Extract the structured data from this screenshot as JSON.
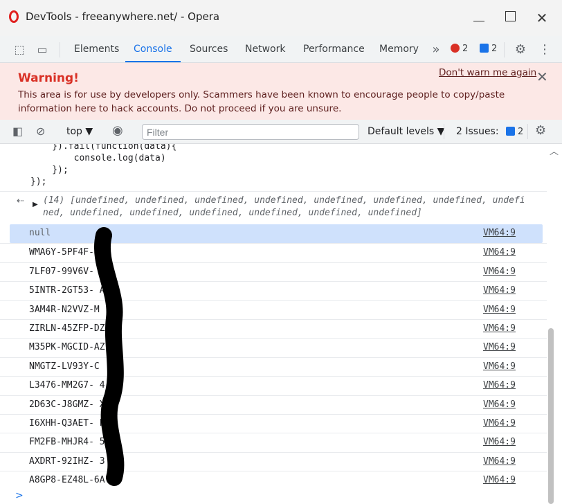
{
  "window": {
    "title": "DevTools - freeanywhere.net/ - Opera",
    "minimize_icon": "minimize-icon",
    "maximize_icon": "maximize-icon",
    "close_glyph": "✕"
  },
  "tabs": [
    {
      "label": "Elements"
    },
    {
      "label": "Console",
      "active": true
    },
    {
      "label": "Sources"
    },
    {
      "label": "Network"
    },
    {
      "label": "Performance"
    },
    {
      "label": "Memory"
    }
  ],
  "tabs_bar": {
    "more_tabs": "»",
    "errors_count": "2",
    "messages_count": "2",
    "settings_icon": "gear-icon",
    "menu_glyph": "⋮"
  },
  "warning": {
    "heading": "Warning!",
    "message": "This area is for use by developers only. Scammers have been known to encourage people to copy/paste information here to hack accounts. Do not proceed if you are unsure.",
    "dont_warn": "Don't warn me again",
    "close_glyph": "✕"
  },
  "console_toolbar": {
    "context": "top ▼",
    "filter_placeholder": "Filter",
    "filter_value": "",
    "levels": "Default levels ▼",
    "issues_label": "2 Issues:",
    "issues_count": "2"
  },
  "console": {
    "code_lines": [
      "    }).fail(function(data){",
      "        console.log(data)",
      "    });",
      "});"
    ],
    "result_text": "(14) [undefined, undefined, undefined, undefined, undefined, undefined, undefined, undefined, undefined, undefined, undefined, undefined, undefined, undefined]",
    "log_rows": [
      {
        "value": "null",
        "source": "VM64:9"
      },
      {
        "value": "WMA6Y-5PF4F-    DP",
        "source": "VM64:9"
      },
      {
        "value": "7LF07-99V6V-    ET",
        "source": "VM64:9"
      },
      {
        "value": "5INTR-2GT53-    A",
        "source": "VM64:9"
      },
      {
        "value": "3AM4R-N2VVZ-M",
        "source": "VM64:9"
      },
      {
        "value": "ZIRLN-45ZFP-DZ",
        "source": "VM64:9"
      },
      {
        "value": "M35PK-MGCID-AZ",
        "source": "VM64:9"
      },
      {
        "value": "NMGTZ-LV93Y-C",
        "source": "VM64:9"
      },
      {
        "value": "L3476-MM2G7-    4",
        "source": "VM64:9"
      },
      {
        "value": "2D63C-J8GMZ-    X",
        "source": "VM64:9"
      },
      {
        "value": "I6XHH-Q3AET-    P",
        "source": "VM64:9"
      },
      {
        "value": "FM2FB-MHJR4-    5E",
        "source": "VM64:9"
      },
      {
        "value": "AXDRT-92IHZ-    3",
        "source": "VM64:9"
      },
      {
        "value": "A8GP8-EZ48L-6A    6",
        "source": "VM64:9"
      }
    ],
    "prompt_glyph": ">"
  },
  "colors": {
    "accent": "#1a73e8",
    "warning_bg": "#fce8e6",
    "warning_heading": "#d93025",
    "selected_row": "#cfe1fc",
    "error_badge": "#d93025"
  }
}
